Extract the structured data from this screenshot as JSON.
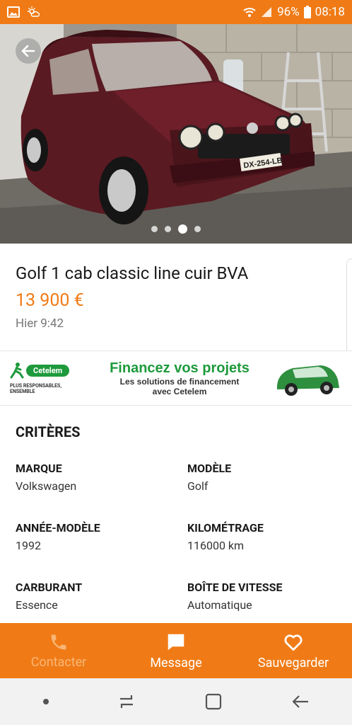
{
  "status_bar": {
    "battery": "96%",
    "time": "08:18",
    "icons": [
      "image-icon",
      "weather-icon",
      "wifi-icon",
      "signal-icon",
      "battery-icon"
    ]
  },
  "photo": {
    "carousel_count": 4,
    "carousel_active": 3,
    "plate": "DX-254-LB"
  },
  "ad": {
    "title": "Golf 1 cab classic line cuir BVA",
    "price": "13 900 €",
    "date": "Hier 9:42"
  },
  "banner": {
    "brand": "Cetelem",
    "tagline": "PLUS RESPONSABLES, ENSEMBLE",
    "headline": "Financez vos projets",
    "sub1": "Les solutions de financement",
    "sub2": "avec Cetelem"
  },
  "criteria": {
    "heading": "CRITÈRES",
    "items": [
      {
        "label": "MARQUE",
        "value": "Volkswagen"
      },
      {
        "label": "MODÈLE",
        "value": "Golf"
      },
      {
        "label": "ANNÉE-MODÈLE",
        "value": "1992"
      },
      {
        "label": "KILOMÉTRAGE",
        "value": "116000 km"
      },
      {
        "label": "CARBURANT",
        "value": "Essence"
      },
      {
        "label": "BOÎTE DE VITESSE",
        "value": "Automatique"
      }
    ]
  },
  "actions": {
    "call": "Contacter",
    "message": "Message",
    "save": "Sauvegarder"
  },
  "colors": {
    "accent": "#f07b16",
    "cetelem_green": "#1e9a3c"
  }
}
